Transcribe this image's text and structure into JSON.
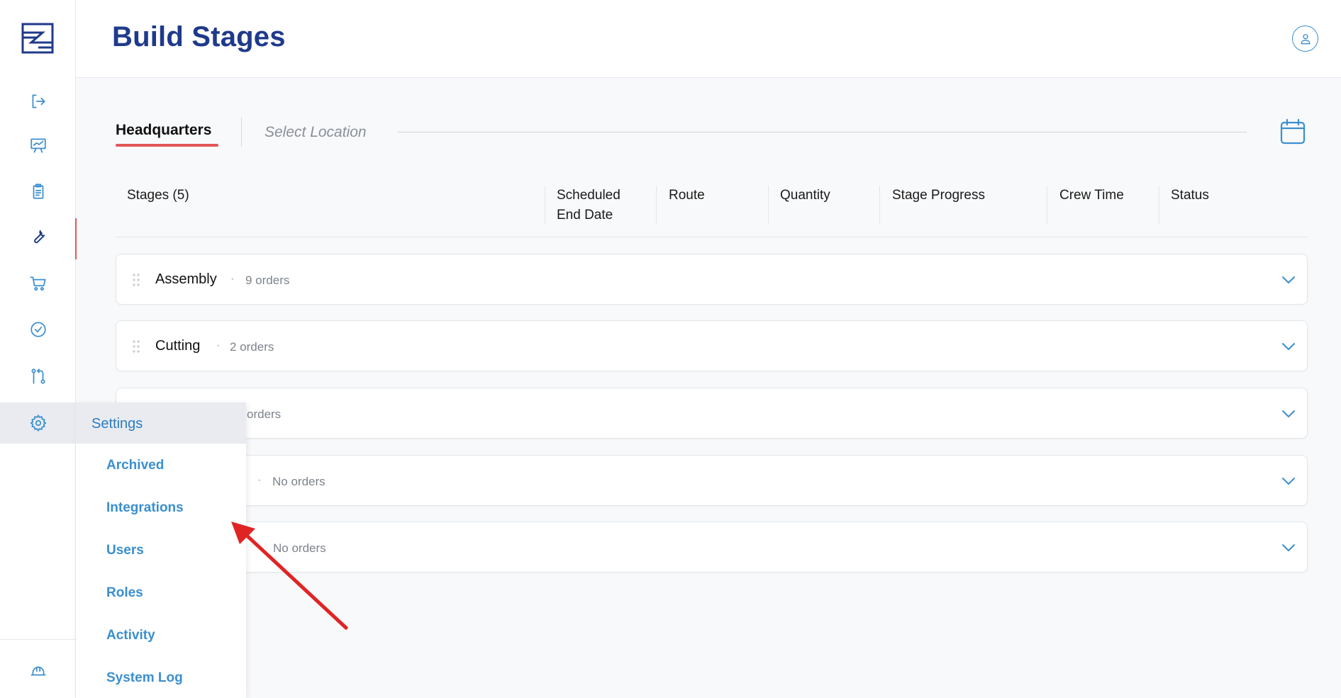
{
  "header": {
    "title": "Build Stages"
  },
  "location_bar": {
    "active_tab": "Headquarters",
    "select_placeholder": "Select Location"
  },
  "table": {
    "columns": [
      "Stages (5)",
      "Scheduled End Date",
      "Route",
      "Quantity",
      "Stage Progress",
      "Crew Time",
      "Status"
    ],
    "scheduled_line1": "Scheduled",
    "scheduled_line2": "End Date"
  },
  "stages": [
    {
      "name": "Assembly",
      "orders": "9 orders"
    },
    {
      "name": "Cutting",
      "orders": "2 orders"
    },
    {
      "name": "",
      "orders": "orders"
    },
    {
      "name": "",
      "orders": "No orders"
    },
    {
      "name": "",
      "orders": "No orders"
    }
  ],
  "settings_menu": {
    "title": "Settings",
    "items": [
      "Archived",
      "Integrations",
      "Users",
      "Roles",
      "Activity",
      "System Log"
    ]
  },
  "sidebar": {
    "icons": [
      "logout-icon",
      "presentation-chart-icon",
      "clipboard-icon",
      "wrench-icon",
      "cart-icon",
      "check-circle-icon",
      "git-route-icon",
      "gear-icon",
      "hard-hat-icon"
    ],
    "active_item": "wrench-icon"
  },
  "colors": {
    "brand": "#1f3a8a",
    "accent": "#3b8fcf",
    "active_underline": "#e25757",
    "annotation_arrow": "#e02424"
  }
}
